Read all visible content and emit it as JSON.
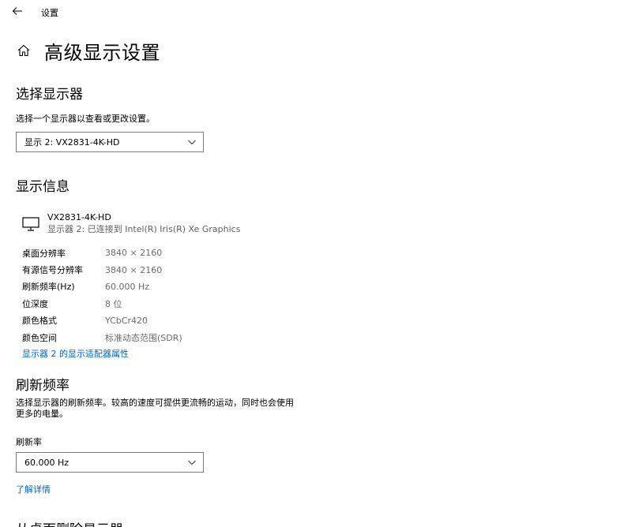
{
  "titlebar": {
    "back_icon": "back-arrow-icon",
    "title": "设置"
  },
  "header": {
    "home_icon": "home-icon",
    "title": "高级显示设置"
  },
  "select_display": {
    "heading": "选择显示器",
    "description": "选择一个显示器以查看或更改设置。",
    "selected": "显示 2: VX2831-4K-HD"
  },
  "display_info": {
    "heading": "显示信息",
    "monitor_icon": "monitor-icon",
    "monitor_name": "VX2831-4K-HD",
    "monitor_connection": "显示器 2: 已连接到 Intel(R) Iris(R) Xe Graphics",
    "rows": [
      {
        "key": "桌面分辨率",
        "value": "3840 × 2160"
      },
      {
        "key": "有源信号分辨率",
        "value": "3840 × 2160"
      },
      {
        "key": "刷新频率(Hz)",
        "value": "60.000 Hz"
      },
      {
        "key": "位深度",
        "value": "8 位"
      },
      {
        "key": "颜色格式",
        "value": "YCbCr420"
      },
      {
        "key": "颜色空间",
        "value": "标准动态范围(SDR)"
      }
    ],
    "adapter_link": "显示器 2 的显示适配器属性"
  },
  "refresh": {
    "heading": "刷新频率",
    "description_line1": "选择显示器的刷新频率。较高的速度可提供更流畅的运动，同时也会使用",
    "description_line2": "更多的电量。",
    "label": "刷新率",
    "selected": "60.000 Hz",
    "learn_more": "了解详情"
  },
  "next_section": {
    "heading": "从桌面删除显示器"
  },
  "colors": {
    "link": "#0067c0",
    "muted": "#6b6b6b",
    "border": "#7a7a7a"
  }
}
